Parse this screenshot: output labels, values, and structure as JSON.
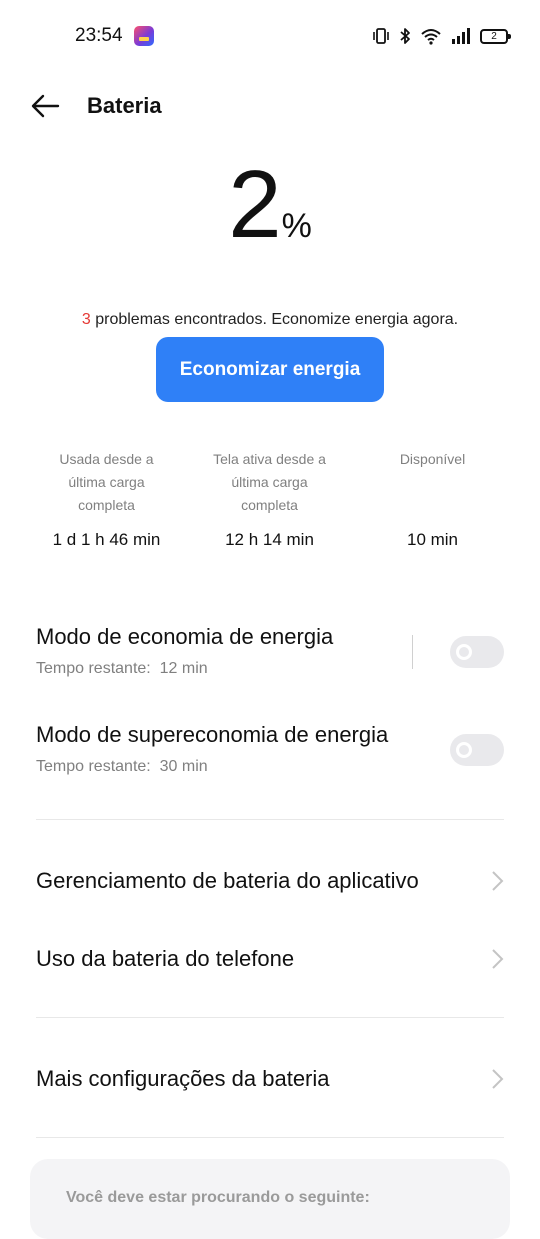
{
  "status_bar": {
    "time": "23:54",
    "battery_level": "2"
  },
  "header": {
    "title": "Bateria"
  },
  "battery": {
    "percent_value": "2",
    "percent_sign": "%"
  },
  "problems": {
    "count": "3",
    "message": " problemas encontrados. Economize energia agora."
  },
  "save_button_label": "Economizar energia",
  "stats": [
    {
      "label": "Usada desde a última carga completa",
      "value": "1 d 1 h 46 min"
    },
    {
      "label": "Tela ativa desde a última carga completa",
      "value": "12 h 14 min"
    },
    {
      "label": "Disponível",
      "value": "10 min"
    }
  ],
  "power_saving": {
    "title": "Modo de economia de energia",
    "subtitle": "Tempo restante:  12 min",
    "enabled": false
  },
  "super_power_saving": {
    "title": "Modo de supereconomia de energia",
    "subtitle": "Tempo restante:  30 min",
    "enabled": false
  },
  "nav_items": [
    {
      "label": "Gerenciamento de bateria do aplicativo"
    },
    {
      "label": "Uso da bateria do telefone"
    },
    {
      "label": "Mais configurações da bateria"
    }
  ],
  "suggestion": {
    "title": "Você deve estar procurando o seguinte:"
  },
  "colors": {
    "accent": "#2f80f7",
    "problem_count": "#e53935",
    "secondary_text": "#808080",
    "toggle_off": "#e9e9ec"
  }
}
